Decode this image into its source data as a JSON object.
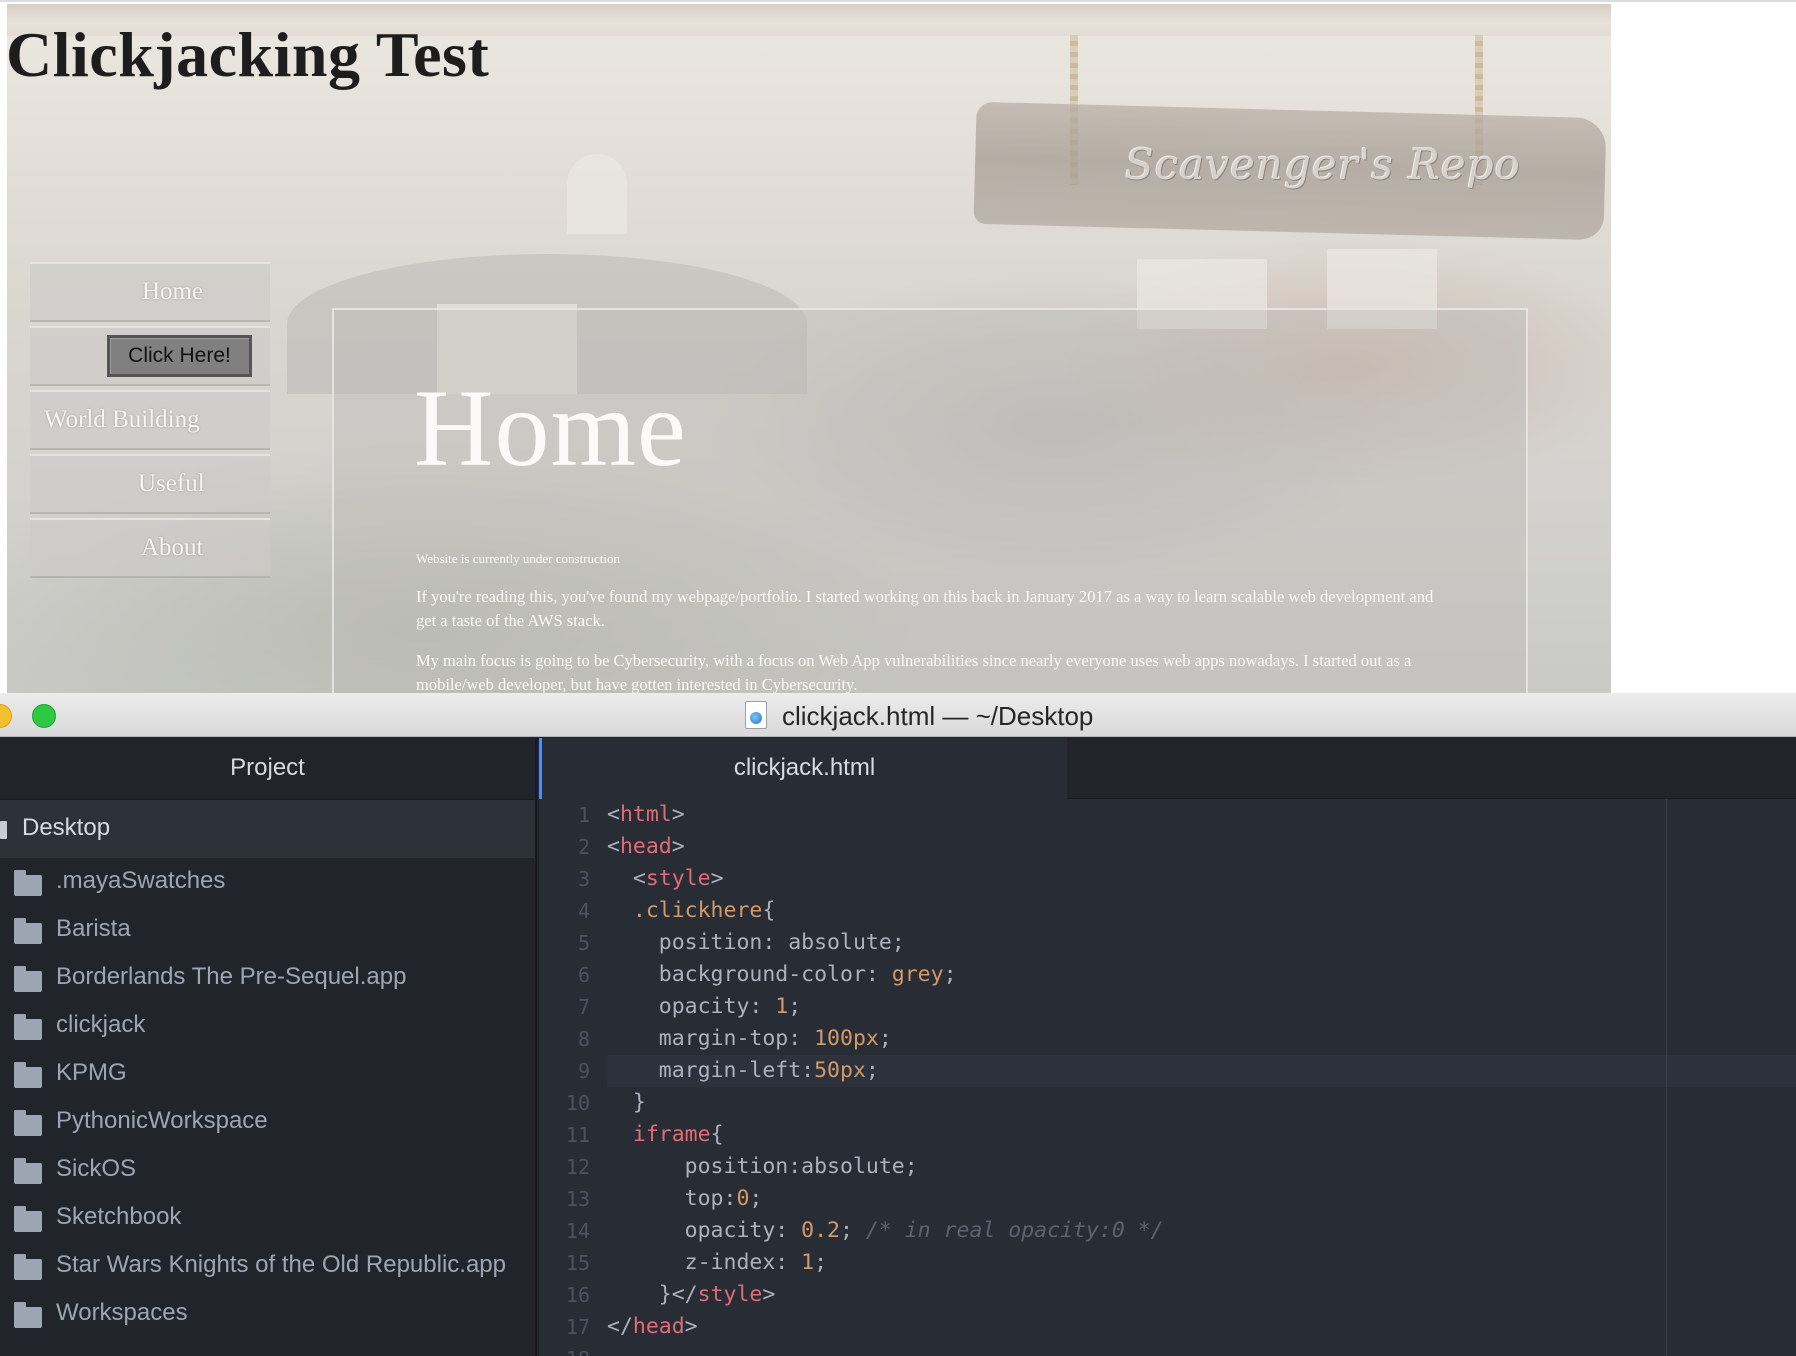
{
  "browser": {
    "page_title": "Clickjacking Test",
    "sign_text": "Scavenger's Repo",
    "click_button": "Click Here!",
    "nav": [
      {
        "label": "Home",
        "align": "center"
      },
      {
        "label": "",
        "align": "center"
      },
      {
        "label": "World Building",
        "align": "left"
      },
      {
        "label": "Useful",
        "align": "center"
      },
      {
        "label": "About",
        "align": "center"
      }
    ],
    "panel": {
      "heading": "Home",
      "note": "Website is currently under construction",
      "paragraphs": [
        "If you're reading this, you've found my webpage/portfolio. I started working on this back in January 2017 as a way to learn scalable web development and get a taste of the AWS stack.",
        "My main focus is going to be Cybersecurity, with a focus on Web App vulnerabilities since nearly everyone uses web apps nowadays. I started out as a mobile/web developer, but have gotten interested in Cybersecurity."
      ]
    }
  },
  "editor": {
    "window_title": "clickjack.html — ~/Desktop",
    "sidebar": {
      "header": "Project",
      "root": "Desktop",
      "items": [
        ".mayaSwatches",
        "Barista",
        "Borderlands The Pre-Sequel.app",
        "clickjack",
        "KPMG",
        "PythonicWorkspace",
        "SickOS",
        "Sketchbook",
        "Star Wars Knights of the Old Republic.app",
        "Workspaces"
      ]
    },
    "tab": "clickjack.html",
    "cursor_line": 9,
    "code_lines": [
      [
        [
          "p",
          "<"
        ],
        [
          "t",
          "html"
        ],
        [
          "p",
          ">"
        ]
      ],
      [
        [
          "p",
          "<"
        ],
        [
          "t",
          "head"
        ],
        [
          "p",
          ">"
        ]
      ],
      [
        [
          "p",
          "  <"
        ],
        [
          "t",
          "style"
        ],
        [
          "p",
          ">"
        ]
      ],
      [
        [
          "p",
          "  "
        ],
        [
          "c",
          ".clickhere"
        ],
        [
          "p",
          "{"
        ]
      ],
      [
        [
          "p",
          "    position: absolute;"
        ]
      ],
      [
        [
          "p",
          "    background-color: "
        ],
        [
          "n",
          "grey"
        ],
        [
          "p",
          ";"
        ]
      ],
      [
        [
          "p",
          "    opacity: "
        ],
        [
          "n",
          "1"
        ],
        [
          "p",
          ";"
        ]
      ],
      [
        [
          "p",
          "    margin-top: "
        ],
        [
          "n",
          "100px"
        ],
        [
          "p",
          ";"
        ]
      ],
      [
        [
          "p",
          "    margin-left:"
        ],
        [
          "n",
          "50px"
        ],
        [
          "p",
          ";"
        ]
      ],
      [
        [
          "p",
          "  }"
        ]
      ],
      [
        [
          "p",
          "  "
        ],
        [
          "t",
          "iframe"
        ],
        [
          "p",
          "{"
        ]
      ],
      [
        [
          "p",
          "      position:absolute;"
        ]
      ],
      [
        [
          "p",
          "      top:"
        ],
        [
          "n",
          "0"
        ],
        [
          "p",
          ";"
        ]
      ],
      [
        [
          "p",
          "      opacity: "
        ],
        [
          "n",
          "0.2"
        ],
        [
          "p",
          "; "
        ],
        [
          "m",
          "/* in real opacity:0 */"
        ]
      ],
      [
        [
          "p",
          "      z-index: "
        ],
        [
          "n",
          "1"
        ],
        [
          "p",
          ";"
        ]
      ],
      [
        [
          "p",
          "    }</"
        ],
        [
          "t",
          "style"
        ],
        [
          "p",
          ">"
        ]
      ],
      [
        [
          "p",
          "</"
        ],
        [
          "t",
          "head"
        ],
        [
          "p",
          ">"
        ]
      ],
      []
    ]
  }
}
